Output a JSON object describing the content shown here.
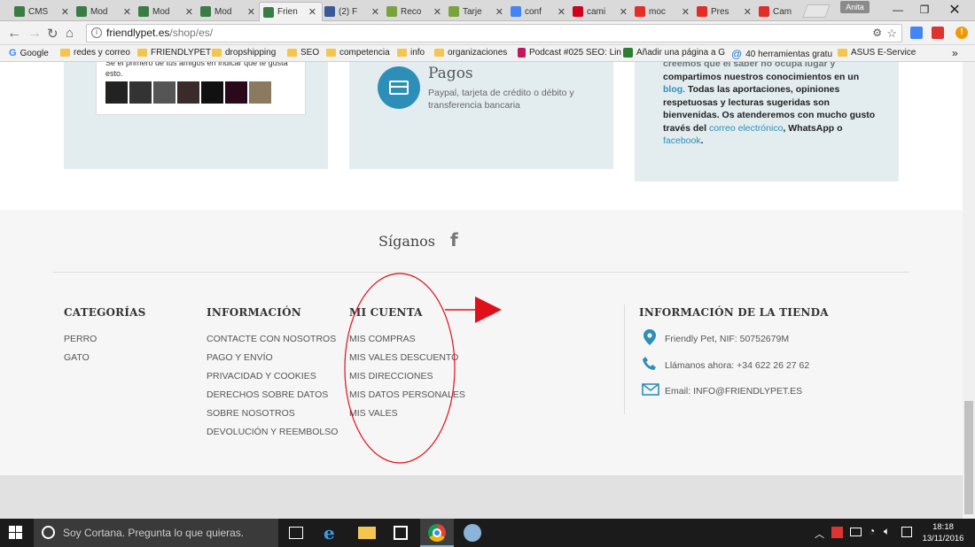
{
  "browser": {
    "tabs": [
      {
        "label": "CMS",
        "color": "#3a7d44",
        "active": false
      },
      {
        "label": "Mod",
        "color": "#3a7d44",
        "active": false
      },
      {
        "label": "Mod",
        "color": "#3a7d44",
        "active": false
      },
      {
        "label": "Mod",
        "color": "#3a7d44",
        "active": false
      },
      {
        "label": "Frien",
        "color": "#3a7d44",
        "active": true
      },
      {
        "label": "(2) F",
        "color": "#3b5998",
        "active": false
      },
      {
        "label": "Reco",
        "color": "#7aa33b",
        "active": false
      },
      {
        "label": "Tarje",
        "color": "#7aa33b",
        "active": false
      },
      {
        "label": "conf",
        "color": "#4285f4",
        "active": false
      },
      {
        "label": "cami",
        "color": "#d0021b",
        "active": false
      },
      {
        "label": "moc",
        "color": "#e52d27",
        "active": false
      },
      {
        "label": "Pres",
        "color": "#e52d27",
        "active": false
      },
      {
        "label": "Cam",
        "color": "#e52d27",
        "active": false
      }
    ],
    "user_badge": "Anita",
    "url_host": "friendlypet.es",
    "url_path": "/shop/es/",
    "bookmarks": [
      {
        "label": "Google",
        "kind": "g"
      },
      {
        "label": "redes y correo",
        "kind": "folder"
      },
      {
        "label": "FRIENDLYPET",
        "kind": "folder"
      },
      {
        "label": "dropshipping",
        "kind": "folder"
      },
      {
        "label": "SEO",
        "kind": "folder"
      },
      {
        "label": "competencia",
        "kind": "folder"
      },
      {
        "label": "info",
        "kind": "folder"
      },
      {
        "label": "organizaciones",
        "kind": "folder"
      },
      {
        "label": "Podcast #025 SEO: Lin",
        "kind": "pod"
      },
      {
        "label": "Añadir una página a G",
        "kind": "img"
      },
      {
        "label": "40 herramientas gratu",
        "kind": "at"
      },
      {
        "label": "ASUS E-Service",
        "kind": "folder"
      }
    ],
    "bookmarks_more": "»"
  },
  "top_section": {
    "friends_text": "Sé el primero de tus amigos en indicar que te gusta esto.",
    "pagos": {
      "title": "Pagos",
      "desc": "Paypal, tarjeta de crédito o débito y transferencia bancaria"
    },
    "blog_text": {
      "line0": "creemos que el saber no ocupa lugar y",
      "line1": "compartimos nuestros conocimientos en un",
      "line1_link": "blog.",
      "line1_rest": "Todas las aportaciones, opiniones",
      "line2": "respetuosas y lecturas sugeridas son",
      "line3": "bienvenidas. Os atenderemos con mucho gusto",
      "line4_pre": "través del",
      "line4_link": "correo electrónico",
      "line4_post": ", WhatsApp o",
      "line5_link": "facebook",
      "line5_post": "."
    }
  },
  "footer": {
    "follow_title": "Síganos",
    "categorias": {
      "title": "CATEGORÍAS",
      "links": [
        "PERRO",
        "GATO"
      ]
    },
    "informacion": {
      "title": "INFORMACIÓN",
      "links": [
        "CONTACTE CON NOSOTROS",
        "PAGO Y ENVÍO",
        "PRIVACIDAD Y COOKIES",
        "DERECHOS SOBRE DATOS",
        "SOBRE NOSOTROS",
        "DEVOLUCIÓN Y REEMBOLSO"
      ]
    },
    "mi_cuenta": {
      "title": "MI CUENTA",
      "links": [
        "MIS COMPRAS",
        "MIS VALES DESCUENTO",
        "MIS DIRECCIONES",
        "MIS DATOS PERSONALES",
        "MIS VALES"
      ]
    },
    "tienda": {
      "title": "INFORMACIÓN DE LA TIENDA",
      "address": "Friendly Pet, NIF: 50752679M",
      "phone": "Llámanos ahora: +34 622 26 27 62",
      "email": "Email: INFO@FRIENDLYPET.ES"
    }
  },
  "annotation": {
    "ellipse_color": "#e0101a",
    "arrow_color": "#e0101a"
  },
  "taskbar": {
    "search_placeholder": "Soy Cortana. Pregunta lo que quieras.",
    "time": "18:18",
    "date": "13/11/2016"
  }
}
